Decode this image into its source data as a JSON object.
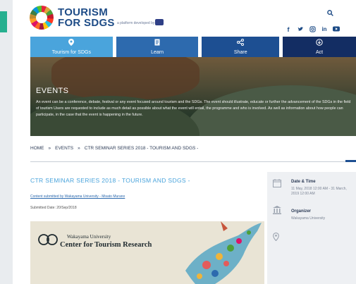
{
  "site": {
    "brand_line1": "TOURISM",
    "brand_line2": "FOR SDGS",
    "brand_sub": "a platform developed by",
    "search_icon": "search-icon",
    "social_icons": [
      "facebook-icon",
      "twitter-icon",
      "instagram-icon",
      "linkedin-icon",
      "youtube-icon"
    ],
    "colors": {
      "primary": "#1d4b86",
      "accent": "#4aa4dc",
      "teal": "#26b08f"
    }
  },
  "nav": [
    {
      "label": "Tourism for SDGs",
      "icon": "location-pin-icon"
    },
    {
      "label": "Learn",
      "icon": "document-icon"
    },
    {
      "label": "Share",
      "icon": "share-icon"
    },
    {
      "label": "Act",
      "icon": "act-icon"
    }
  ],
  "hero": {
    "title": "EVENTS",
    "text": "An event can be a conference, debate, festival or any event focused around tourism and the SDGs. The event should illustrate, educate or further the advancement of the SDGs in the field of tourism Users are requested to include as much detail as possible about what the event will entail, the programme and who is involved. As well as information about how people can participate, in the case that the event is happening in the future."
  },
  "breadcrumb": {
    "home": "HOME",
    "sep": "»",
    "events": "EVENTS",
    "current": "CTR SEMINAR SERIES 2018 - TOURISM AND SDGS -"
  },
  "article": {
    "title": "CTR SEMINAR SERIES 2018 - TOURISM AND SDGS -",
    "submitted_by": "Content submitted by Wakayama University - Misato Murano",
    "submitted_date": "Submitted Date: 20/Sep/2018",
    "banner_university": "Wakayama University",
    "banner_center": "Center for Tourism Research"
  },
  "sidebar": {
    "date_heading": "Date & Time",
    "date_value": "11 May, 2018 12:00 AM - 31 March, 2019 12:00 AM",
    "org_heading": "Organizer",
    "org_value": "Wakayama University",
    "calendar_icon": "calendar-icon",
    "org_icon": "building-icon",
    "location_icon": "location-pin-icon"
  }
}
